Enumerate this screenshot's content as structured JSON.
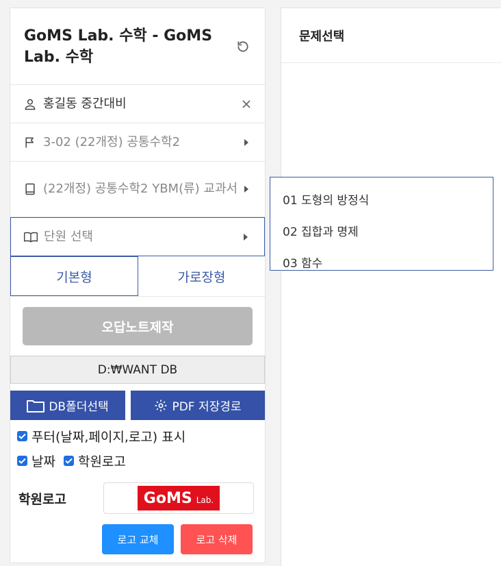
{
  "header": {
    "title": "GoMS Lab. 수학 - GoMS Lab. 수학"
  },
  "rows": {
    "student": "홍길동 중간대비",
    "course": "3-02 (22개정) 공통수학2",
    "textbook": "(22개정) 공통수학2 YBM(류) 교과서",
    "unit": "단원 선택"
  },
  "tabs": {
    "basic": "기본형",
    "landscape": "가로장형"
  },
  "make_button": "오답노트제작",
  "db_path": "D:₩WANT DB",
  "buttons": {
    "db_folder": "DB폴더선택",
    "pdf_path": "PDF 저장경로"
  },
  "checks": {
    "footer": "푸터(날짜,페이지,로고) 표시",
    "date": "날짜",
    "logo": "학원로고"
  },
  "logo": {
    "label": "학원로고",
    "img_main": "GoMS",
    "img_sub": "Lab."
  },
  "logo_actions": {
    "replace": "로고 교체",
    "delete": "로고 삭제"
  },
  "right": {
    "title": "문제선택"
  },
  "dropdown": {
    "items": [
      "01 도형의 방정식",
      "02 집합과 명제",
      "03 함수"
    ]
  },
  "colors": {
    "accent": "#3b5aa6",
    "button_blue": "#3552a8",
    "replace": "#1e90ff",
    "delete": "#ff5252",
    "disabled": "#b9b9b9"
  }
}
